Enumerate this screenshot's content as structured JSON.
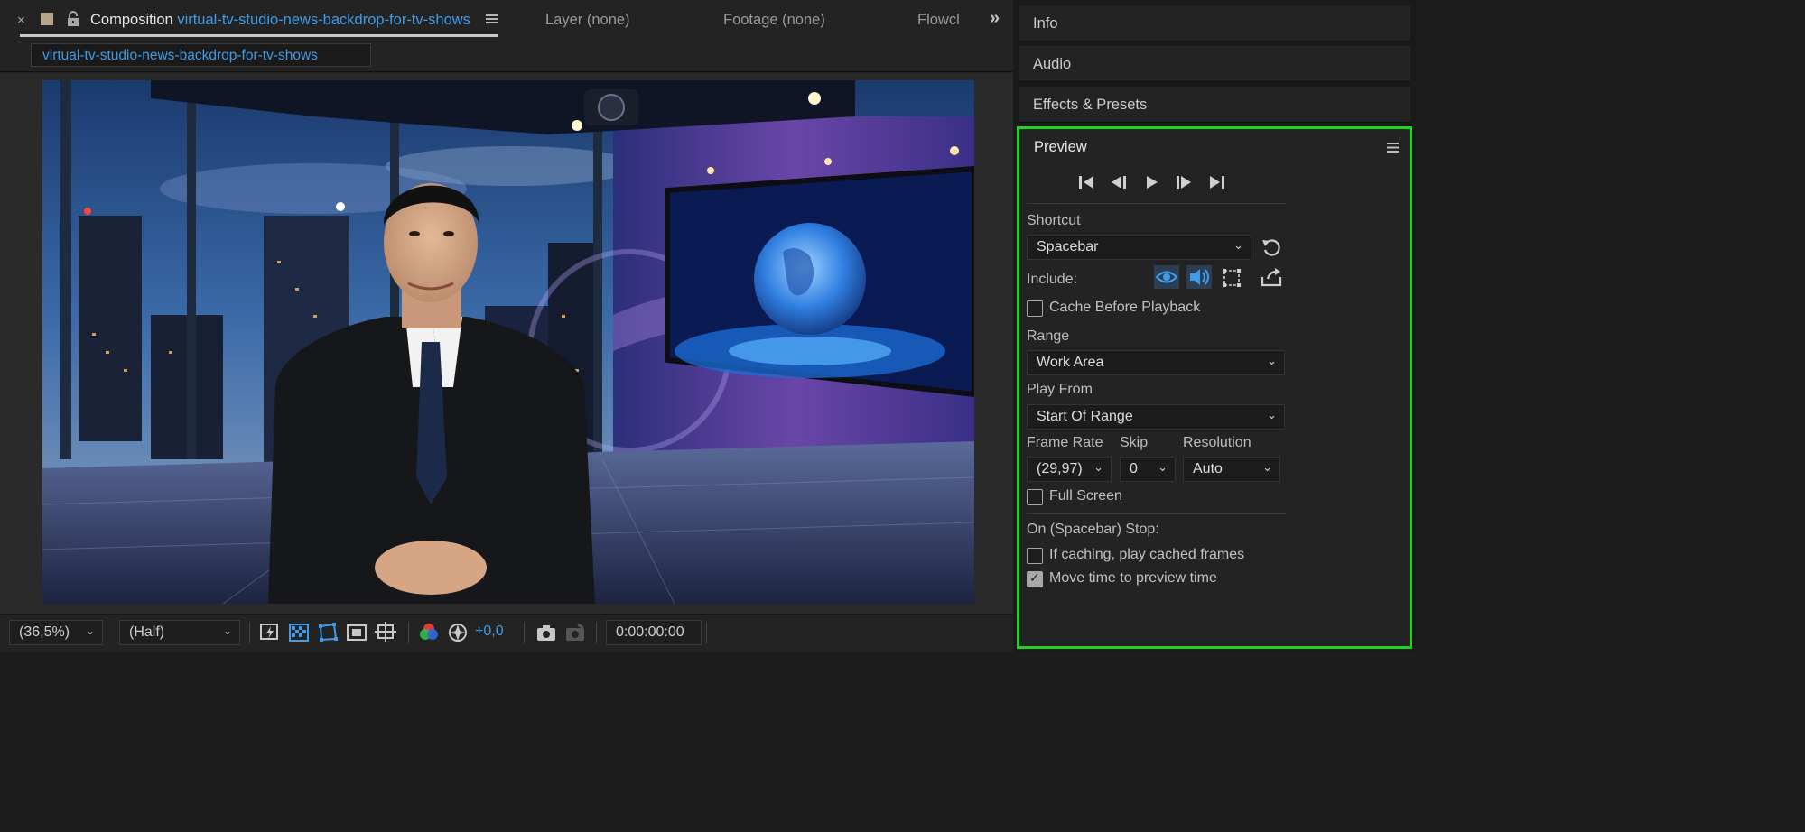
{
  "composition_panel": {
    "tab_title_prefix": "Composition",
    "tab_comp_name": "virtual-tv-studio-news-backdrop-for-tv-shows",
    "breadcrumb": "virtual-tv-studio-news-backdrop-for-tv-shows",
    "other_tabs": {
      "layer": "Layer (none)",
      "footage": "Footage (none)",
      "flowchart": "Flowcl"
    },
    "close_glyph": "×",
    "more_glyph": "»"
  },
  "viewer_toolbar": {
    "zoom": "(36,5%)",
    "resolution": "(Half)",
    "exposure": "+0,0",
    "timecode": "0:00:00:00"
  },
  "right_panels": {
    "info": "Info",
    "audio": "Audio",
    "effects": "Effects & Presets"
  },
  "preview": {
    "title": "Preview",
    "shortcut_label": "Shortcut",
    "shortcut_value": "Spacebar",
    "include_label": "Include:",
    "cache_before_playback": {
      "label": "Cache Before Playback",
      "checked": false
    },
    "range_label": "Range",
    "range_value": "Work Area",
    "play_from_label": "Play From",
    "play_from_value": "Start Of Range",
    "frame_rate_label": "Frame Rate",
    "frame_rate_value": "(29,97)",
    "skip_label": "Skip",
    "skip_value": "0",
    "resolution_label": "Resolution",
    "resolution_value": "Auto",
    "full_screen": {
      "label": "Full Screen",
      "checked": false
    },
    "on_stop_label": "On (Spacebar) Stop:",
    "if_caching": {
      "label": "If caching, play cached frames",
      "checked": false
    },
    "move_time": {
      "label": "Move time to preview time",
      "checked": true
    }
  },
  "colors": {
    "accent_blue": "#3f9ce8",
    "highlight_green": "#21d321",
    "panel_bg": "#232323"
  }
}
